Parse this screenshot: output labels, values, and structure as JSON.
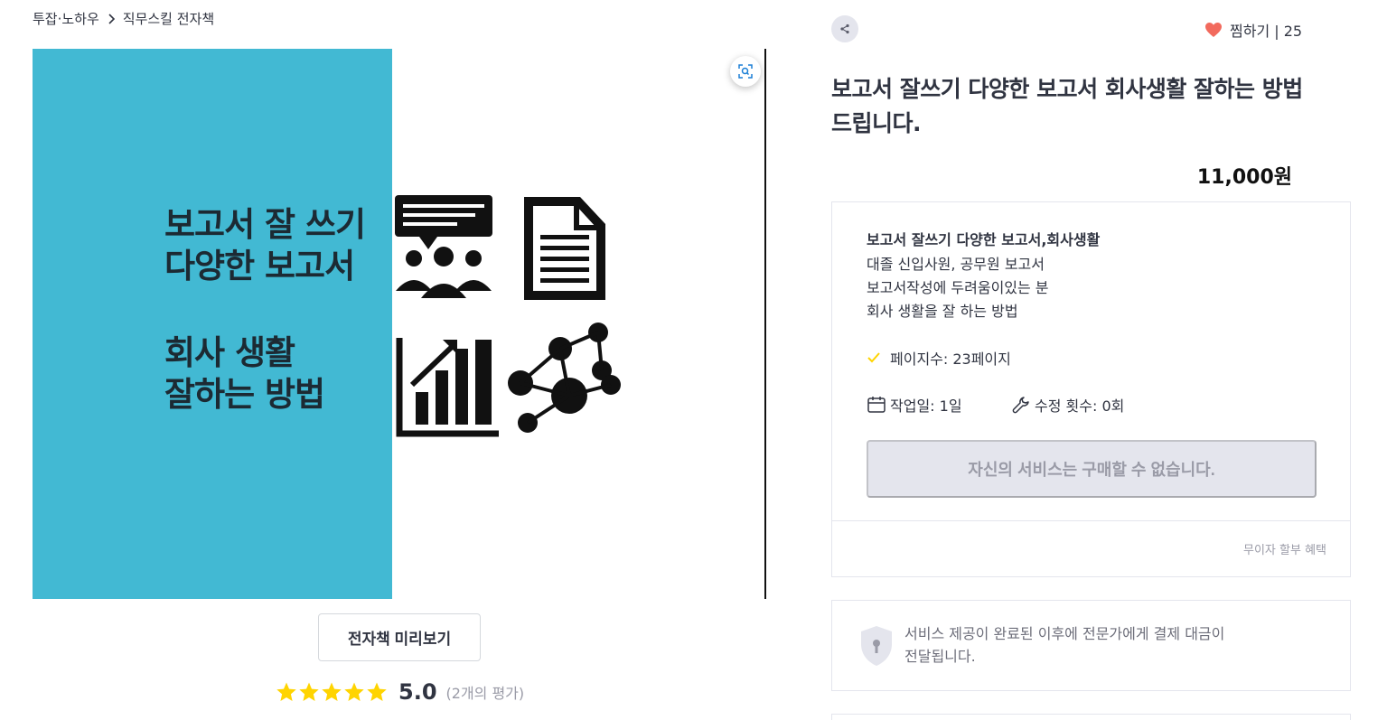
{
  "breadcrumb": {
    "category": "투잡·노하우",
    "subcategory": "직무스킬 전자책"
  },
  "image": {
    "cover_line1": "보고서 잘 쓰기",
    "cover_line2": "다양한 보고서",
    "cover_line3": "회사 생활",
    "cover_line4": "잘하는 방법",
    "accent_color": "#42b9d3"
  },
  "preview_button": "전자책 미리보기",
  "rating": {
    "score": "5.0",
    "count_text": "(2개의 평가)",
    "stars": 5,
    "star_color": "#ffd400"
  },
  "wishlist": {
    "label": "찜하기 | 25",
    "heart_color": "#f26a5d"
  },
  "product": {
    "title": "보고서 잘쓰기 다양한 보고서 회사생활 잘하는 방법 드립니다.",
    "price": "11,000원"
  },
  "package": {
    "name": "보고서 잘쓰기 다양한 보고서,회사생활",
    "desc_line1": "대졸 신입사원, 공무원  보고서",
    "desc_line2": "보고서작성에 두려움이있는 분",
    "desc_line3": "회사 생활을 잘 하는 방법",
    "pages": "페이지수:  23페이지",
    "work_days": "작업일:  1일",
    "revisions": "수정 횟수:  0회",
    "buy_disabled_label": "자신의 서비스는 구매할 수 없습니다.",
    "installment_link": "무이자 할부 혜택",
    "check_color": "#ffd400"
  },
  "notice": {
    "line1": "서비스 제공이 완료된 이후에 전문가에게 결제 대금이",
    "line2": "전달됩니다."
  },
  "icons": {
    "chevron": "chevron-right-icon",
    "zoom": "zoom-icon",
    "share": "share-icon",
    "heart": "heart-icon",
    "star": "star-icon",
    "check": "check-icon",
    "calendar": "calendar-icon",
    "wrench": "wrench-icon",
    "shield": "shield-icon"
  }
}
